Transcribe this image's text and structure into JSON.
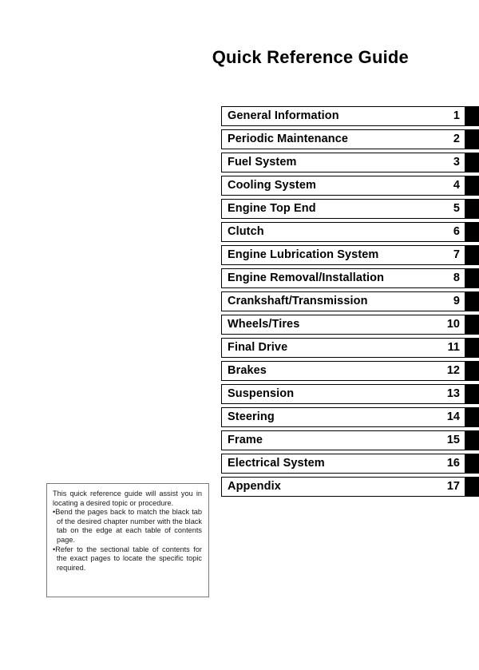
{
  "document": {
    "title": "Quick Reference Guide"
  },
  "chapter_index": {
    "rows": [
      {
        "title": "General Information",
        "number": "1"
      },
      {
        "title": "Periodic Maintenance",
        "number": "2"
      },
      {
        "title": "Fuel System",
        "number": "3"
      },
      {
        "title": "Cooling System",
        "number": "4"
      },
      {
        "title": "Engine Top End",
        "number": "5"
      },
      {
        "title": "Clutch",
        "number": "6"
      },
      {
        "title": "Engine Lubrication System",
        "number": "7"
      },
      {
        "title": "Engine Removal/Installation",
        "number": "8"
      },
      {
        "title": "Crankshaft/Transmission",
        "number": "9"
      },
      {
        "title": "Wheels/Tires",
        "number": "10"
      },
      {
        "title": "Final Drive",
        "number": "11"
      },
      {
        "title": "Brakes",
        "number": "12"
      },
      {
        "title": "Suspension",
        "number": "13"
      },
      {
        "title": "Steering",
        "number": "14"
      },
      {
        "title": "Frame",
        "number": "15"
      },
      {
        "title": "Electrical System",
        "number": "16"
      },
      {
        "title": "Appendix",
        "number": "17"
      }
    ]
  },
  "note": {
    "paragraph": "This quick reference guide will assist you in locating a desired topic or procedure.",
    "bullets": [
      "•Bend the pages back to match the black tab of the desired chapter number with the black tab on the edge at each table of contents page.",
      "•Refer to the sectional table of contents for the exact pages to locate the specific topic required."
    ]
  },
  "colors": {
    "tab_black": "#000000",
    "box_border": "#000000",
    "note_border": "#7a7a7a",
    "page_background": "#ffffff",
    "text": "#000000"
  }
}
